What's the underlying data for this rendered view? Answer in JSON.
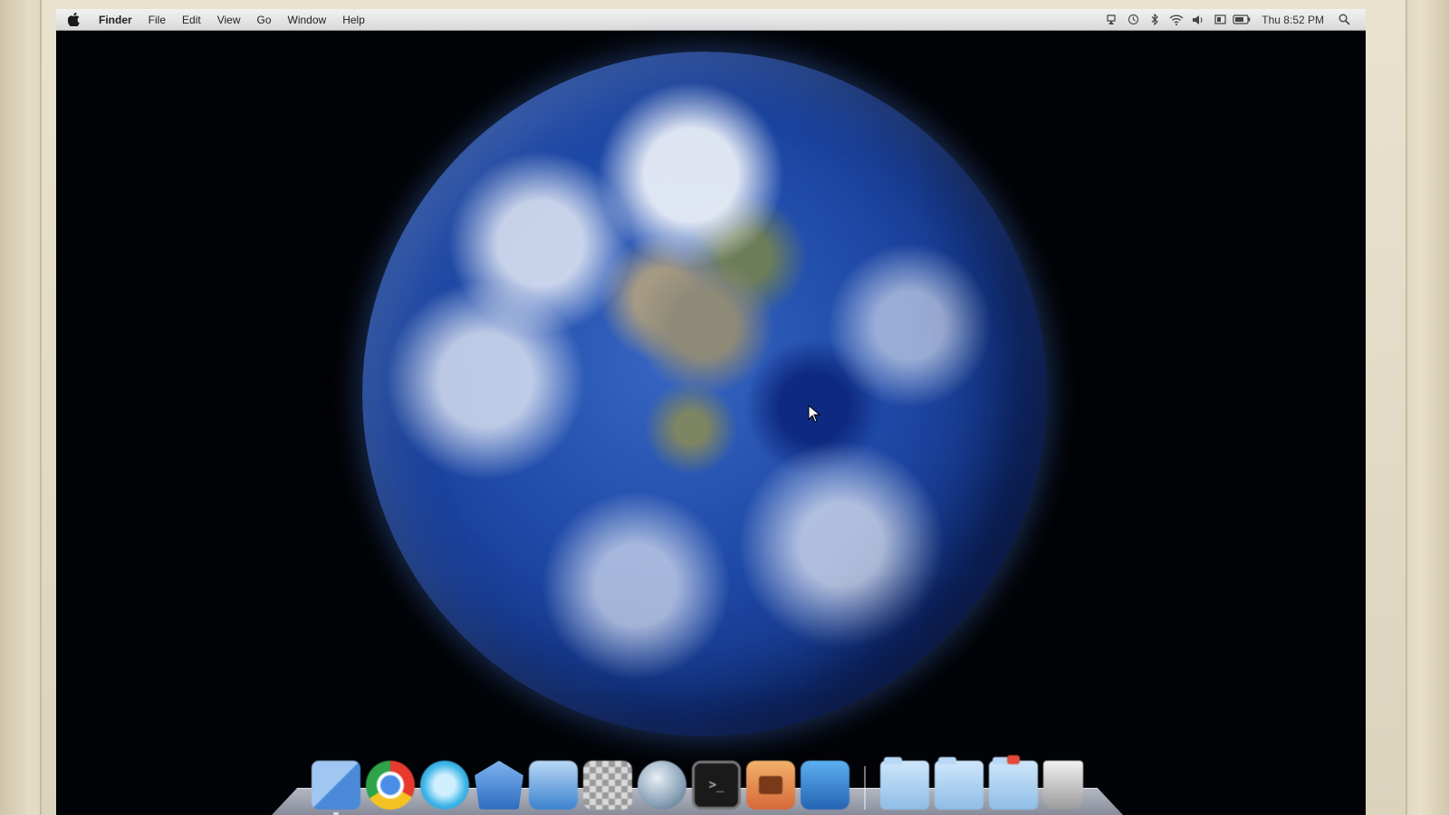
{
  "menubar": {
    "apple_icon": "apple-logo-icon",
    "app_name": "Finder",
    "menus": [
      "File",
      "Edit",
      "View",
      "Go",
      "Window",
      "Help"
    ],
    "status_icons": [
      "airplay-icon",
      "time-machine-icon",
      "bluetooth-icon",
      "wifi-icon",
      "volume-icon",
      "display-icon",
      "battery-icon"
    ],
    "clock": "Thu 8:52 PM",
    "spotlight_icon": "spotlight-search-icon"
  },
  "desktop": {
    "wallpaper": "earth-globe-wallpaper",
    "cursor_icon": "arrow-cursor-icon"
  },
  "dock": {
    "apps": [
      {
        "name": "finder-icon"
      },
      {
        "name": "chrome-icon"
      },
      {
        "name": "safari-icon"
      },
      {
        "name": "mail-icon"
      },
      {
        "name": "preview-icon"
      },
      {
        "name": "grid-app-icon"
      },
      {
        "name": "globe-app-icon"
      },
      {
        "name": "terminal-icon"
      },
      {
        "name": "photo-app-icon"
      },
      {
        "name": "system-preferences-icon"
      }
    ],
    "stacks": [
      {
        "name": "applications-folder-icon"
      },
      {
        "name": "documents-folder-icon"
      },
      {
        "name": "downloads-folder-icon"
      },
      {
        "name": "trash-icon"
      }
    ]
  },
  "colors": {
    "menubar_top": "#f2f2f2",
    "menubar_bottom": "#d9d9d9",
    "desktop_bg": "#020306",
    "ocean": "#1f4aa8",
    "bezel": "#e4dcc6"
  }
}
